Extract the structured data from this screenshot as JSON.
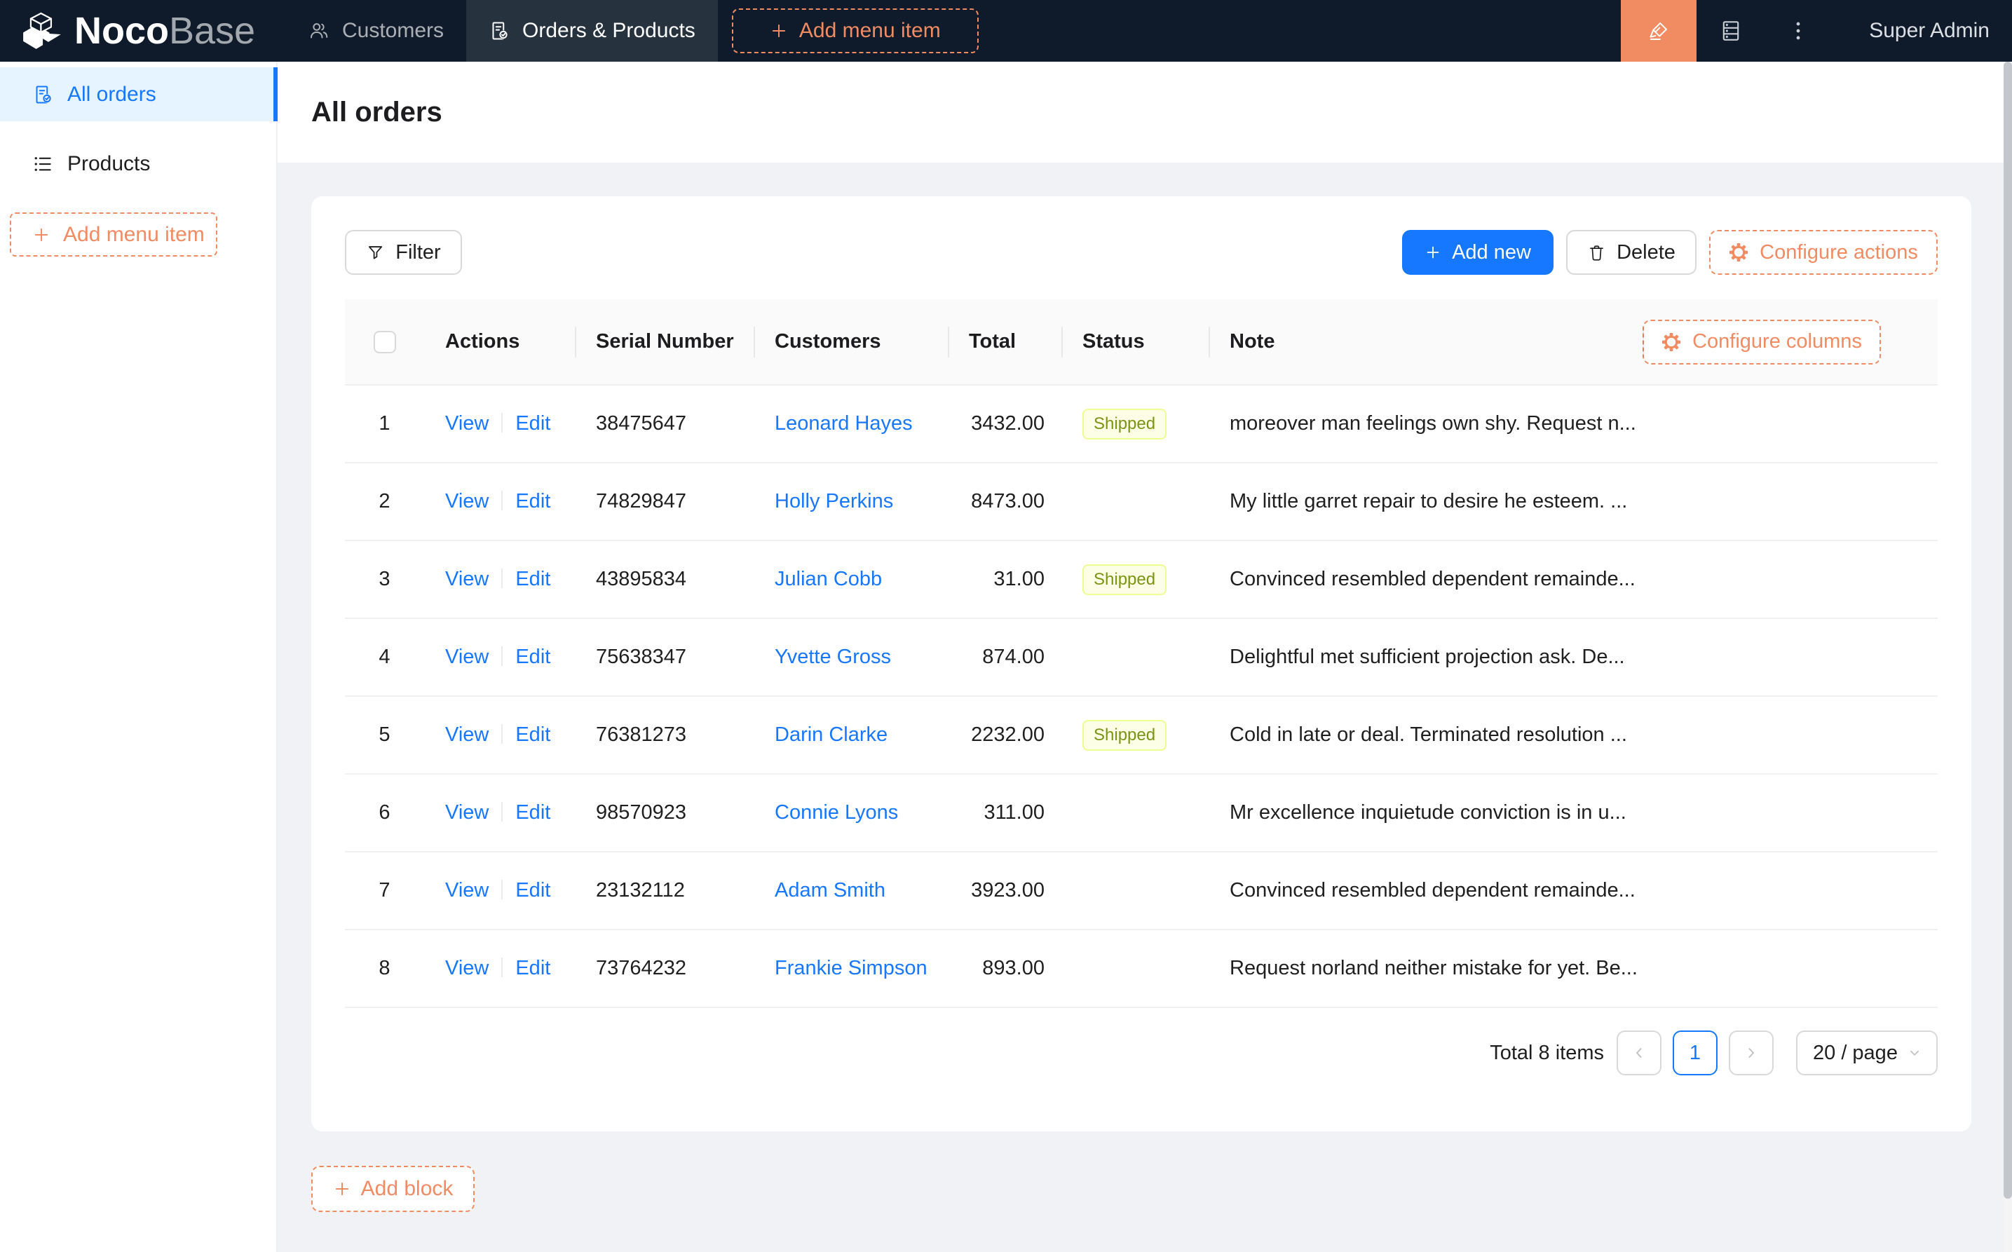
{
  "brand": {
    "name_primary": "Noco",
    "name_secondary": "Base"
  },
  "header": {
    "tabs": [
      {
        "label": "Customers",
        "icon": "team-icon",
        "active": false
      },
      {
        "label": "Orders & Products",
        "icon": "file-done-icon",
        "active": true
      }
    ],
    "add_menu_item_label": "Add menu item",
    "user": "Super Admin",
    "ui_editor_color": "#f18b62"
  },
  "sidebar": {
    "items": [
      {
        "label": "All orders",
        "icon": "file-done-icon",
        "active": true
      },
      {
        "label": "Products",
        "icon": "list-icon",
        "active": false
      }
    ],
    "add_menu_item_label": "Add menu item"
  },
  "page": {
    "title": "All orders"
  },
  "toolbar": {
    "filter_label": "Filter",
    "add_new_label": "Add new",
    "delete_label": "Delete",
    "configure_actions_label": "Configure actions"
  },
  "table": {
    "columns": [
      "Actions",
      "Serial Number",
      "Customers",
      "Total",
      "Status",
      "Note"
    ],
    "configure_columns_label": "Configure columns",
    "action_labels": {
      "view": "View",
      "edit": "Edit"
    },
    "status_tag": {
      "bg": "#fcffe6",
      "border": "#eaff8f",
      "text": "#7a9413"
    },
    "rows": [
      {
        "index": "1",
        "serial": "38475647",
        "customer": "Leonard Hayes",
        "total": "3432.00",
        "status": "Shipped",
        "note": "moreover man feelings own shy. Request n..."
      },
      {
        "index": "2",
        "serial": "74829847",
        "customer": "Holly Perkins",
        "total": "8473.00",
        "status": "",
        "note": "My little garret repair to desire he esteem. ..."
      },
      {
        "index": "3",
        "serial": "43895834",
        "customer": "Julian Cobb",
        "total": "31.00",
        "status": "Shipped",
        "note": "Convinced resembled dependent remainde..."
      },
      {
        "index": "4",
        "serial": "75638347",
        "customer": "Yvette Gross",
        "total": "874.00",
        "status": "",
        "note": "Delightful met sufficient projection ask. De..."
      },
      {
        "index": "5",
        "serial": "76381273",
        "customer": "Darin Clarke",
        "total": "2232.00",
        "status": "Shipped",
        "note": "Cold in late or deal. Terminated resolution ..."
      },
      {
        "index": "6",
        "serial": "98570923",
        "customer": "Connie Lyons",
        "total": "311.00",
        "status": "",
        "note": "Mr excellence inquietude conviction is in u..."
      },
      {
        "index": "7",
        "serial": "23132112",
        "customer": "Adam Smith",
        "total": "3923.00",
        "status": "",
        "note": "Convinced resembled dependent remainde..."
      },
      {
        "index": "8",
        "serial": "73764232",
        "customer": "Frankie Simpson",
        "total": "893.00",
        "status": "",
        "note": "Request norland neither mistake for yet. Be..."
      }
    ]
  },
  "pagination": {
    "total_text": "Total 8 items",
    "current_page": "1",
    "page_size_label": "20 / page"
  },
  "add_block_label": "Add block",
  "colors": {
    "primary": "#1677ff",
    "settings_orange": "#f18b62",
    "header_bg": "#0f1b2a",
    "layout_bg": "#f0f2f5"
  }
}
